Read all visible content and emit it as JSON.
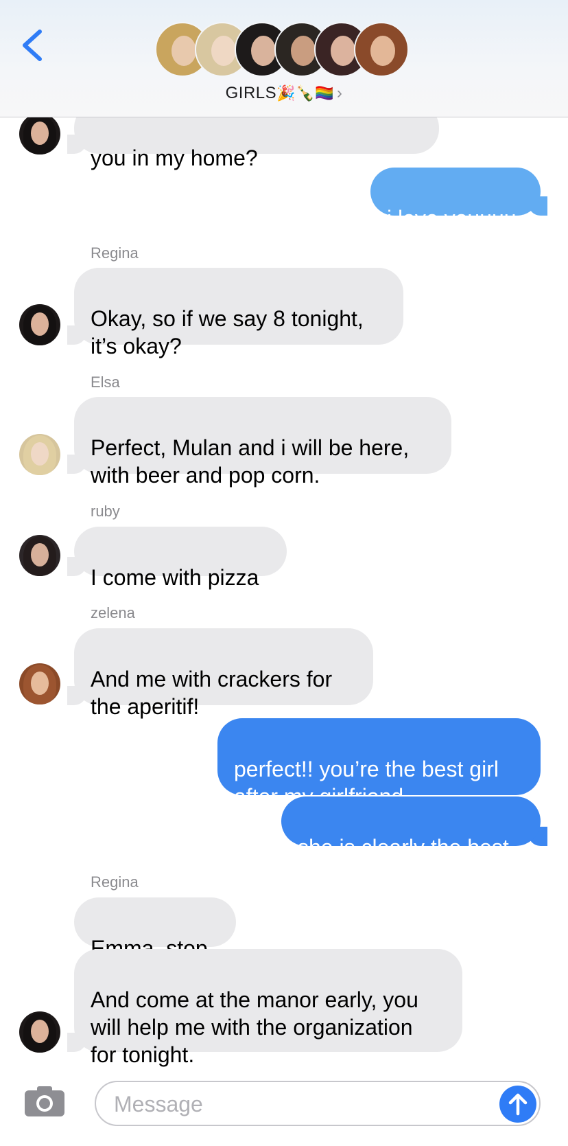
{
  "header": {
    "group_name": "GIRLS",
    "group_emojis": "🎉🍾🏳️‍🌈",
    "chevron": "›"
  },
  "messages": [
    {
      "direction": "in",
      "text": "you in my home?"
    },
    {
      "direction": "out",
      "text": "i love youuuu"
    },
    {
      "direction": "in",
      "sender": "Regina",
      "text": "Okay, so if we say 8 tonight,\nit’s okay?"
    },
    {
      "direction": "in",
      "sender": "Elsa",
      "text": "Perfect, Mulan and i will be here,\nwith beer and pop corn."
    },
    {
      "direction": "in",
      "sender": "ruby",
      "text": "I come with pizza"
    },
    {
      "direction": "in",
      "sender": "zelena",
      "text": "And me with crackers for\nthe aperitif!"
    },
    {
      "direction": "out",
      "text": "perfect!! you’re the best girl\nafter my girlfriend"
    },
    {
      "direction": "out",
      "text": "she is clearly the best"
    },
    {
      "direction": "in",
      "sender": "Regina",
      "text": "Emma, stop."
    },
    {
      "direction": "in",
      "text": "And come at the manor early, you\nwill help me with the organization\nfor tonight."
    }
  ],
  "input": {
    "placeholder": "Message"
  },
  "colors": {
    "outgoing_bubble": "#3b86f0",
    "incoming_bubble": "#e9e9eb",
    "accent": "#2f7cf6"
  },
  "icons": [
    "back-chevron-icon",
    "camera-icon",
    "send-arrow-icon"
  ]
}
